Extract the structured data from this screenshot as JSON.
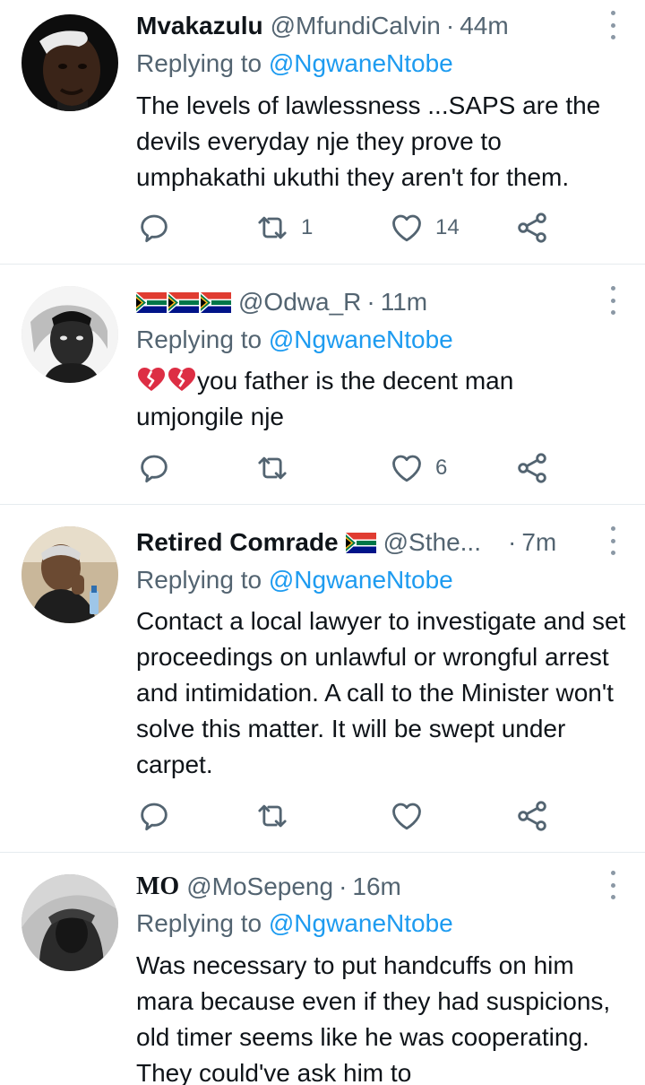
{
  "tweets": [
    {
      "name": "Mvakazulu",
      "handle": "@MfundiCalvin",
      "separator": "·",
      "time": "44m",
      "replying_label": "Replying to",
      "replying_to": "@NgwaneNtobe",
      "text": "The levels of lawlessness ...SAPS are the devils everyday nje they prove to umphakathi ukuthi they aren't for them.",
      "retweets": "1",
      "likes": "14"
    },
    {
      "name": "",
      "name_flags": [
        "south-africa-flag",
        "south-africa-flag",
        "south-africa-flag"
      ],
      "handle": "@Odwa_R",
      "separator": "·",
      "time": "11m",
      "replying_label": "Replying to",
      "replying_to": "@NgwaneNtobe",
      "text_emoji": [
        "broken-heart-emoji",
        "broken-heart-emoji"
      ],
      "text": "you father is the decent man umjongile nje",
      "retweets": "",
      "likes": "6"
    },
    {
      "name": "Retired Comrade",
      "name_flags": [
        "south-africa-flag"
      ],
      "handle": "@Sthe...",
      "separator": "·",
      "time": "7m",
      "replying_label": "Replying to",
      "replying_to": "@NgwaneNtobe",
      "text": "Contact a local lawyer to investigate and set proceedings on unlawful or wrongful arrest and intimidation. A call to the Minister won't solve this matter. It will be swept under carpet.",
      "retweets": "",
      "likes": ""
    },
    {
      "name": "MO",
      "handle": "@MoSepeng",
      "separator": "·",
      "time": "16m",
      "replying_label": "Replying to",
      "replying_to": "@NgwaneNtobe",
      "text": "Was necessary to put handcuffs on him mara because even if they had suspicions, old timer seems like he was cooperating. They could've ask him to"
    }
  ],
  "colors": {
    "text": "#0f1419",
    "secondary": "#536471",
    "accent": "#1d9bf0",
    "divider": "#e6ebef"
  },
  "icons": [
    "reply-icon",
    "retweet-icon",
    "like-icon",
    "share-icon",
    "more-options-icon"
  ]
}
